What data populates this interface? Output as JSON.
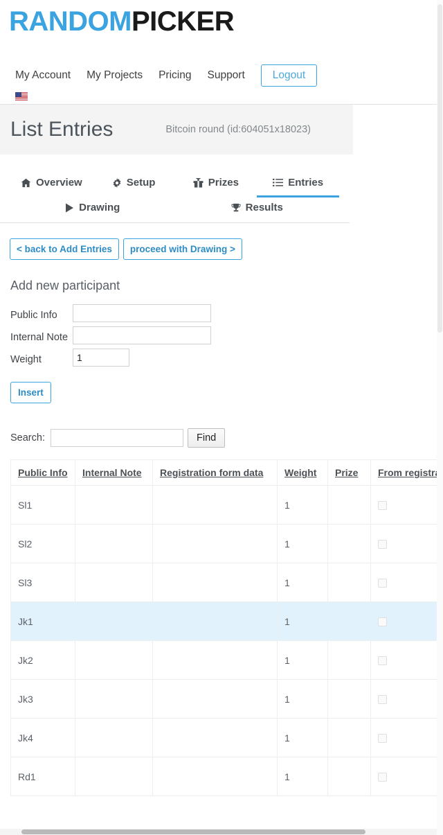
{
  "brand": {
    "name_part1": "RANDOM",
    "name_part2": "PICKER",
    "color_blue": "#3ba4e0",
    "color_dark": "#1a1a1a"
  },
  "nav": {
    "items": [
      {
        "label": "My Account"
      },
      {
        "label": "My Projects"
      },
      {
        "label": "Pricing"
      },
      {
        "label": "Support"
      }
    ],
    "logout_label": "Logout",
    "language_icon": "uk-flag-icon"
  },
  "header": {
    "title": "List Entries",
    "round_label": "Bitcoin round (id:604051x18023)"
  },
  "tabs": [
    {
      "label": "Overview",
      "icon": "home-icon",
      "active": false
    },
    {
      "label": "Setup",
      "icon": "gear-icon",
      "active": false
    },
    {
      "label": "Prizes",
      "icon": "gift-icon",
      "active": false
    },
    {
      "label": "Entries",
      "icon": "list-icon",
      "active": true
    },
    {
      "label": "Drawing",
      "icon": "play-icon",
      "active": false
    },
    {
      "label": "Results",
      "icon": "trophy-icon",
      "active": false
    }
  ],
  "actions": {
    "back_label": "< back to Add Entries",
    "proceed_label": "proceed with Drawing >"
  },
  "add_participant": {
    "section_title": "Add new participant",
    "public_info_label": "Public Info",
    "public_info_value": "",
    "public_info_placeholder": "",
    "internal_note_label": "Internal Note",
    "internal_note_value": "",
    "internal_note_placeholder": "",
    "weight_label": "Weight",
    "weight_value": "1",
    "insert_label": "Insert"
  },
  "search": {
    "label": "Search:",
    "value": "",
    "placeholder": "",
    "find_label": "Find"
  },
  "table": {
    "columns": [
      {
        "label": "Public Info",
        "sortable": true
      },
      {
        "label": "Internal Note",
        "sortable": true
      },
      {
        "label": "Registration form data",
        "sortable": true
      },
      {
        "label": "Weight",
        "sortable": true
      },
      {
        "label": "Prize",
        "sortable": true
      },
      {
        "label": "From registration form",
        "sortable": true
      }
    ],
    "rows": [
      {
        "public_info": "Sl1",
        "internal_note": "",
        "registration_form_data": "",
        "weight": "1",
        "prize": "",
        "from_registration_form": false,
        "highlighted": false
      },
      {
        "public_info": "Sl2",
        "internal_note": "",
        "registration_form_data": "",
        "weight": "1",
        "prize": "",
        "from_registration_form": false,
        "highlighted": false
      },
      {
        "public_info": "Sl3",
        "internal_note": "",
        "registration_form_data": "",
        "weight": "1",
        "prize": "",
        "from_registration_form": false,
        "highlighted": false
      },
      {
        "public_info": "Jk1",
        "internal_note": "",
        "registration_form_data": "",
        "weight": "1",
        "prize": "",
        "from_registration_form": false,
        "highlighted": true
      },
      {
        "public_info": "Jk2",
        "internal_note": "",
        "registration_form_data": "",
        "weight": "1",
        "prize": "",
        "from_registration_form": false,
        "highlighted": false
      },
      {
        "public_info": "Jk3",
        "internal_note": "",
        "registration_form_data": "",
        "weight": "1",
        "prize": "",
        "from_registration_form": false,
        "highlighted": false
      },
      {
        "public_info": "Jk4",
        "internal_note": "",
        "registration_form_data": "",
        "weight": "1",
        "prize": "",
        "from_registration_form": false,
        "highlighted": false
      },
      {
        "public_info": "Rd1",
        "internal_note": "",
        "registration_form_data": "",
        "weight": "1",
        "prize": "",
        "from_registration_form": false,
        "highlighted": false
      }
    ]
  }
}
